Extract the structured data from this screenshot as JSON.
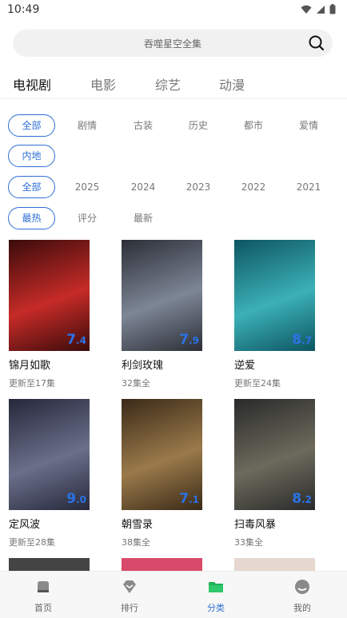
{
  "status_bar": {
    "time": "10:49"
  },
  "search": {
    "placeholder": "吞噬星空全集"
  },
  "tabs": [
    {
      "label": "电视剧",
      "active": true
    },
    {
      "label": "电影",
      "active": false
    },
    {
      "label": "综艺",
      "active": false
    },
    {
      "label": "动漫",
      "active": false
    }
  ],
  "filters": {
    "genre": [
      "全部",
      "剧情",
      "古装",
      "历史",
      "都市",
      "爱情",
      "内地"
    ],
    "year": [
      "全部",
      "2025",
      "2024",
      "2023",
      "2022",
      "2021"
    ],
    "sort": [
      "最热",
      "评分",
      "最新"
    ]
  },
  "shows": [
    {
      "title": "锦月如歌",
      "sub": "更新至17集",
      "score_int": "7",
      "score_dec": ".4",
      "colors": [
        "#3a0b0b",
        "#c62b27"
      ]
    },
    {
      "title": "利剑玫瑰",
      "sub": "32集全",
      "score_int": "7",
      "score_dec": ".9",
      "colors": [
        "#2b2e36",
        "#7d8696"
      ]
    },
    {
      "title": "逆爱",
      "sub": "更新至24集",
      "score_int": "8",
      "score_dec": ".7",
      "colors": [
        "#0d5562",
        "#3bb0b6"
      ]
    },
    {
      "title": "定风波",
      "sub": "更新至28集",
      "score_int": "9",
      "score_dec": ".0",
      "colors": [
        "#26283a",
        "#6a6f8a"
      ]
    },
    {
      "title": "朝雪录",
      "sub": "38集全",
      "score_int": "7",
      "score_dec": ".1",
      "colors": [
        "#3a2a18",
        "#9a7a4a"
      ]
    },
    {
      "title": "扫毒风暴",
      "sub": "33集全",
      "score_int": "8",
      "score_dec": ".2",
      "colors": [
        "#2a2a2a",
        "#6c6a5c"
      ]
    }
  ],
  "bottom_nav": [
    {
      "label": "首页",
      "icon": "home-icon",
      "active": false
    },
    {
      "label": "排行",
      "icon": "ranking-icon",
      "active": false
    },
    {
      "label": "分类",
      "icon": "folder-icon",
      "active": true
    },
    {
      "label": "我的",
      "icon": "profile-icon",
      "active": false
    }
  ],
  "colors": {
    "accent": "#2e6fd6",
    "score": "#2b72e6"
  }
}
